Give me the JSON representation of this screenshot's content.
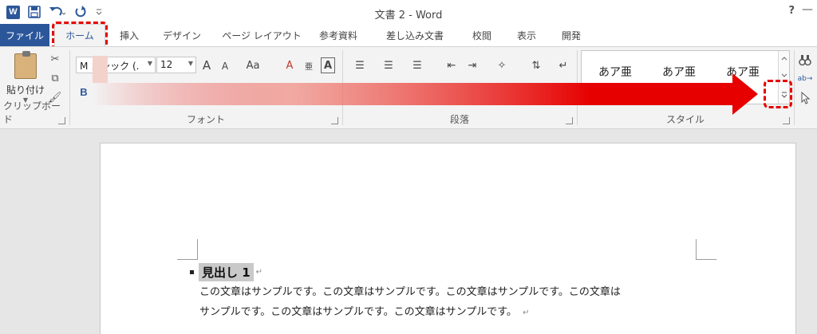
{
  "window": {
    "title": "文書 2 - Word",
    "help": "?"
  },
  "qat": {
    "app_icon": "W"
  },
  "tabs": [
    {
      "label": "ファイル"
    },
    {
      "label": "ホーム"
    },
    {
      "label": "挿入"
    },
    {
      "label": "デザイン"
    },
    {
      "label": "ページ レイアウト"
    },
    {
      "label": "参考資料"
    },
    {
      "label": "差し込み文書"
    },
    {
      "label": "校閲"
    },
    {
      "label": "表示"
    },
    {
      "label": "開発"
    }
  ],
  "ribbon": {
    "clipboard": {
      "paste_label": "貼り付け",
      "group_label": "クリップボード"
    },
    "font": {
      "name": "M  ゴシック (.",
      "size": "12",
      "group_label": "フォント",
      "bold": "B",
      "grow": "A",
      "shrink": "A",
      "case": "Aa",
      "clear_format": "A"
    },
    "paragraph": {
      "group_label": "段落"
    },
    "styles": {
      "group_label": "スタイル",
      "items": [
        {
          "label": "あア亜"
        },
        {
          "label": "あア亜"
        },
        {
          "label": "あア亜"
        }
      ]
    }
  },
  "document": {
    "heading": "見出し 1",
    "body_line1": "この文章はサンプルです。この文章はサンプルです。この文章はサンプルです。この文章は",
    "body_line2": "サンプルです。この文章はサンプルです。この文章はサンプルです。",
    "para_mark": "↵"
  },
  "colors": {
    "word_blue": "#2b579a",
    "annotation_red": "#e60000",
    "ribbon_bg": "#f3f3f3"
  }
}
